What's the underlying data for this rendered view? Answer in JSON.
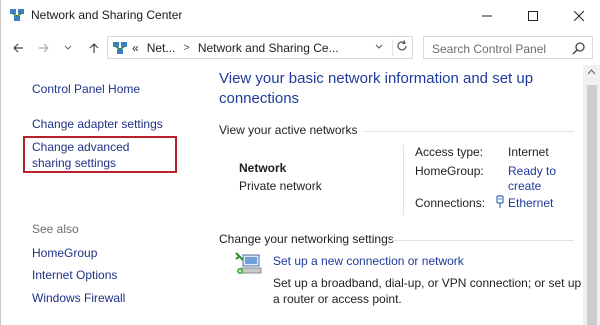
{
  "window": {
    "title": "Network and Sharing Center",
    "minimize_icon": "minimize-icon",
    "maximize_icon": "maximize-icon",
    "close_icon": "close-icon"
  },
  "address_bar": {
    "crumbs": [
      "«",
      "Net...",
      ">",
      "Network and Sharing Ce..."
    ],
    "search_placeholder": "Search Control Panel"
  },
  "left_pane": {
    "home": "Control Panel Home",
    "change_adapter": "Change adapter settings",
    "change_advanced": "Change advanced sharing settings",
    "see_also": "See also",
    "homegroup": "HomeGroup",
    "internet_options": "Internet Options",
    "windows_firewall": "Windows Firewall",
    "highlight_color": "#b5212d"
  },
  "main": {
    "heading": "View your basic network information and set up connections",
    "active_networks_label": "View your active networks",
    "network": {
      "name": "Network",
      "type": "Private network",
      "access_type_label": "Access type:",
      "access_type_value": "Internet",
      "homegroup_label": "HomeGroup:",
      "homegroup_value": "Ready to create",
      "connections_label": "Connections:",
      "connections_value": "Ethernet"
    },
    "change_settings_label": "Change your networking settings",
    "setup_link": "Set up a new connection or network",
    "setup_desc": "Set up a broadband, dial-up, or VPN connection; or set up a router or access point."
  },
  "colors": {
    "link": "#1e3a9e",
    "nav_link": "#1e3287",
    "muted": "#6d6d6d"
  }
}
